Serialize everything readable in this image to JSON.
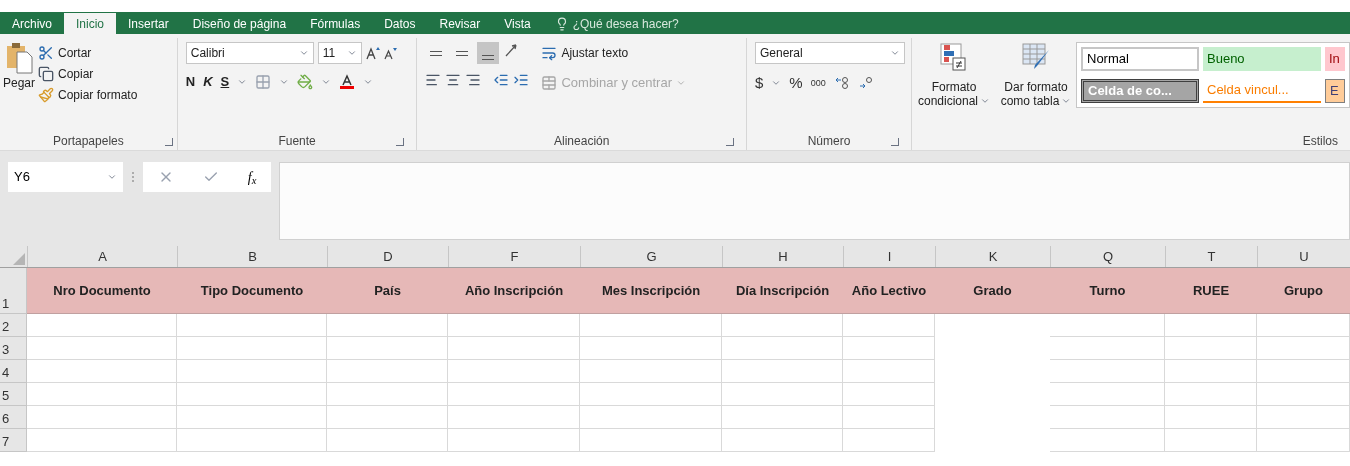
{
  "tabs": [
    {
      "label": "Archivo",
      "selected": false
    },
    {
      "label": "Inicio",
      "selected": true
    },
    {
      "label": "Insertar",
      "selected": false
    },
    {
      "label": "Diseño de página",
      "selected": false
    },
    {
      "label": "Fórmulas",
      "selected": false
    },
    {
      "label": "Datos",
      "selected": false
    },
    {
      "label": "Revisar",
      "selected": false
    },
    {
      "label": "Vista",
      "selected": false
    }
  ],
  "tell_me": "¿Qué desea hacer?",
  "clipboard": {
    "paste": "Pegar",
    "cut": "Cortar",
    "copy": "Copiar",
    "format_painter": "Copiar formato",
    "label": "Portapapeles"
  },
  "font": {
    "name": "Calibri",
    "size": "11",
    "bold": "N",
    "italic": "K",
    "underline": "S",
    "label": "Fuente"
  },
  "alignment": {
    "vertical": [
      {
        "selected": false
      },
      {
        "selected": false
      },
      {
        "selected": true
      }
    ],
    "wrap": "Ajustar texto",
    "merge": "Combinar y centrar",
    "merge_disabled": true,
    "label": "Alineación"
  },
  "number": {
    "format": "General",
    "currency": "$",
    "percent": "%",
    "thousands": "000",
    "label": "Número"
  },
  "styles": {
    "conditional": [
      "Formato",
      "condicional"
    ],
    "as_table": [
      "Dar formato",
      "como tabla"
    ],
    "label": "Estilos",
    "gallery": [
      {
        "label": "Normal",
        "kind": "normal"
      },
      {
        "label": "Bueno",
        "kind": "good"
      },
      {
        "label": "In",
        "kind": "bad"
      },
      {
        "label": "Celda de co...",
        "kind": "check"
      },
      {
        "label": "Celda vincul...",
        "kind": "linked"
      },
      {
        "label": "E",
        "kind": "input"
      }
    ]
  },
  "formula_bar": {
    "name_box": "Y6",
    "fx": "f$_{x}$"
  },
  "sheet": {
    "columns": [
      {
        "letter": "A",
        "header": "Nro Documento",
        "gridlines": true
      },
      {
        "letter": "B",
        "header": "Tipo Documento",
        "gridlines": true
      },
      {
        "letter": "D",
        "header": "País",
        "gridlines": true
      },
      {
        "letter": "F",
        "header": "Año Inscripción",
        "gridlines": true
      },
      {
        "letter": "G",
        "header": "Mes Inscripción",
        "gridlines": true
      },
      {
        "letter": "H",
        "header": "Día Inscripción",
        "gridlines": true
      },
      {
        "letter": "I",
        "header": "Año Lectivo",
        "gridlines": true
      },
      {
        "letter": "K",
        "header": "Grado",
        "gridlines": false
      },
      {
        "letter": "Q",
        "header": "Turno",
        "gridlines": true
      },
      {
        "letter": "T",
        "header": "RUEE",
        "gridlines": true
      },
      {
        "letter": "U",
        "header": "Grupo",
        "gridlines": true
      }
    ],
    "rows": [
      "1",
      "2",
      "3",
      "4",
      "5",
      "6",
      "7"
    ]
  }
}
